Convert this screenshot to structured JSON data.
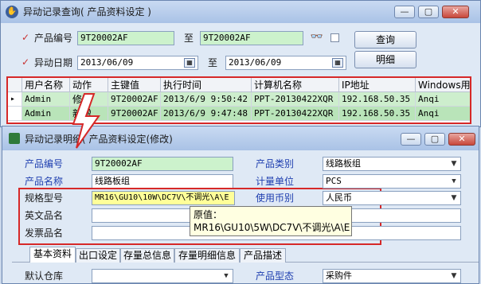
{
  "window1": {
    "title": "异动记录查询( 产品资料设定 )",
    "product_no_label": "产品编号",
    "product_no_from": "9T20002AF",
    "to1": "至",
    "product_no_to": "9T20002AF",
    "date_label": "异动日期",
    "date_from": "2013/06/09",
    "to2": "至",
    "date_to": "2013/06/09",
    "query_button": "查询",
    "detail_button": "明细",
    "binoculars_icon": "binoculars-icon"
  },
  "grid": {
    "columns": [
      "用户名称",
      "动作",
      "主键值",
      "执行时间",
      "计算机名称",
      "IP地址",
      "Windows用"
    ],
    "rows": [
      [
        "Admin",
        "修改",
        "9T20002AF",
        "2013/6/9 9:50:42",
        "PPT-20130422XQR",
        "192.168.50.35",
        "Anqi"
      ],
      [
        "Admin",
        "新增",
        "9T20002AF",
        "2013/6/9 9:47:48",
        "PPT-20130422XQR",
        "192.168.50.35",
        "Anqi"
      ]
    ],
    "row_indicator": "▸"
  },
  "window2": {
    "title": "异动记录明细( 产品资料设定(修改)",
    "product_no_label": "产品编号",
    "product_no": "9T20002AF",
    "product_name_label": "产品名称",
    "product_name": "线路板组",
    "spec_label": "规格型号",
    "spec": "MR16\\GU10\\10W\\DC7V\\不调光\\A\\E",
    "english_name_label": "英文品名",
    "invoice_name_label": "发票品名",
    "category_label": "产品类别",
    "category": "线路板组",
    "unit_label": "计量单位",
    "unit": "PCS",
    "currency_label": "使用币别",
    "currency": "人民币",
    "tooltip_title": "原值：",
    "tooltip_value": "MR16\\GU10\\5W\\DC7V\\不调光\\A\\E",
    "tabs": [
      "基本资料",
      "出口设定",
      "存量总信息",
      "存量明细信息",
      "产品描述"
    ],
    "default_warehouse_label": "默认仓库",
    "product_form_label": "产品型态",
    "product_form": "采购件"
  },
  "colors": {
    "highlight_border": "#d62828",
    "changed_field": "#ffff99",
    "key_field": "#ccf2cc"
  }
}
